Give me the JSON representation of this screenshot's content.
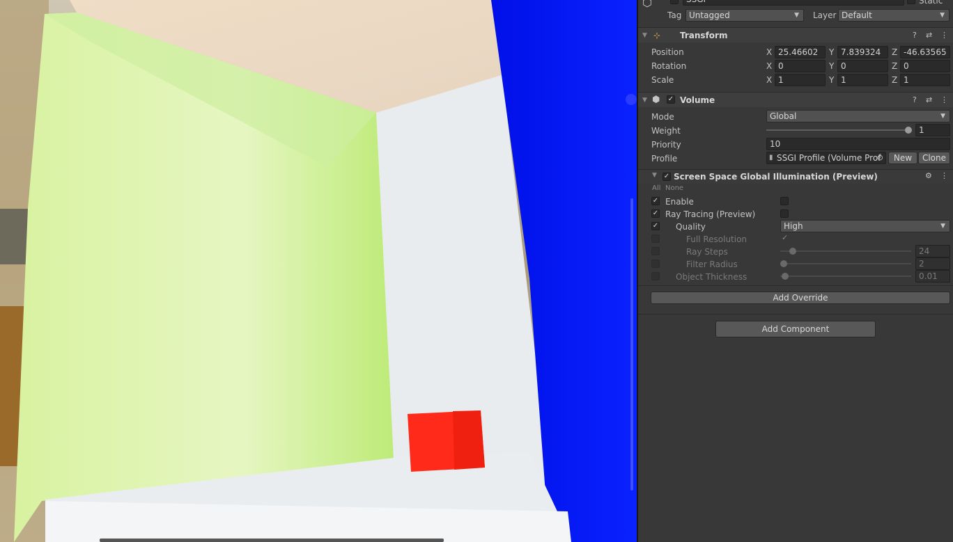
{
  "object": {
    "name": "SSGI",
    "static_label": "Static",
    "tag_label": "Tag",
    "tag_value": "Untagged",
    "layer_label": "Layer",
    "layer_value": "Default"
  },
  "transform": {
    "title": "Transform",
    "position": {
      "label": "Position",
      "x": "25.46602",
      "y": "7.839324",
      "z": "-46.63565"
    },
    "rotation": {
      "label": "Rotation",
      "x": "0",
      "y": "0",
      "z": "0"
    },
    "scale": {
      "label": "Scale",
      "x": "1",
      "y": "1",
      "z": "1"
    },
    "axis_x": "X",
    "axis_y": "Y",
    "axis_z": "Z"
  },
  "volume": {
    "title": "Volume",
    "mode_label": "Mode",
    "mode_value": "Global",
    "weight_label": "Weight",
    "weight_value": "1",
    "weight_fraction": 1.0,
    "priority_label": "Priority",
    "priority_value": "10",
    "profile_label": "Profile",
    "profile_value": "SSGI Profile (Volume Prof",
    "new_button": "New",
    "clone_button": "Clone"
  },
  "ssgi": {
    "title": "Screen Space Global Illumination (Preview)",
    "all_label": "All",
    "none_label": "None",
    "enable_label": "Enable",
    "ray_tracing_label": "Ray Tracing (Preview)",
    "quality_label": "Quality",
    "quality_value": "High",
    "full_res_label": "Full Resolution",
    "ray_steps_label": "Ray Steps",
    "ray_steps_value": "24",
    "filter_radius_label": "Filter Radius",
    "filter_radius_value": "2",
    "object_thickness_label": "Object Thickness",
    "object_thickness_value": "0.01"
  },
  "add_override": "Add Override",
  "add_component": "Add Component",
  "colors": {
    "accent_blue": "#0a14f0",
    "green_wall": "#c8f07a",
    "red_cube": "#ff2a1a",
    "panel_bg": "#383838"
  }
}
